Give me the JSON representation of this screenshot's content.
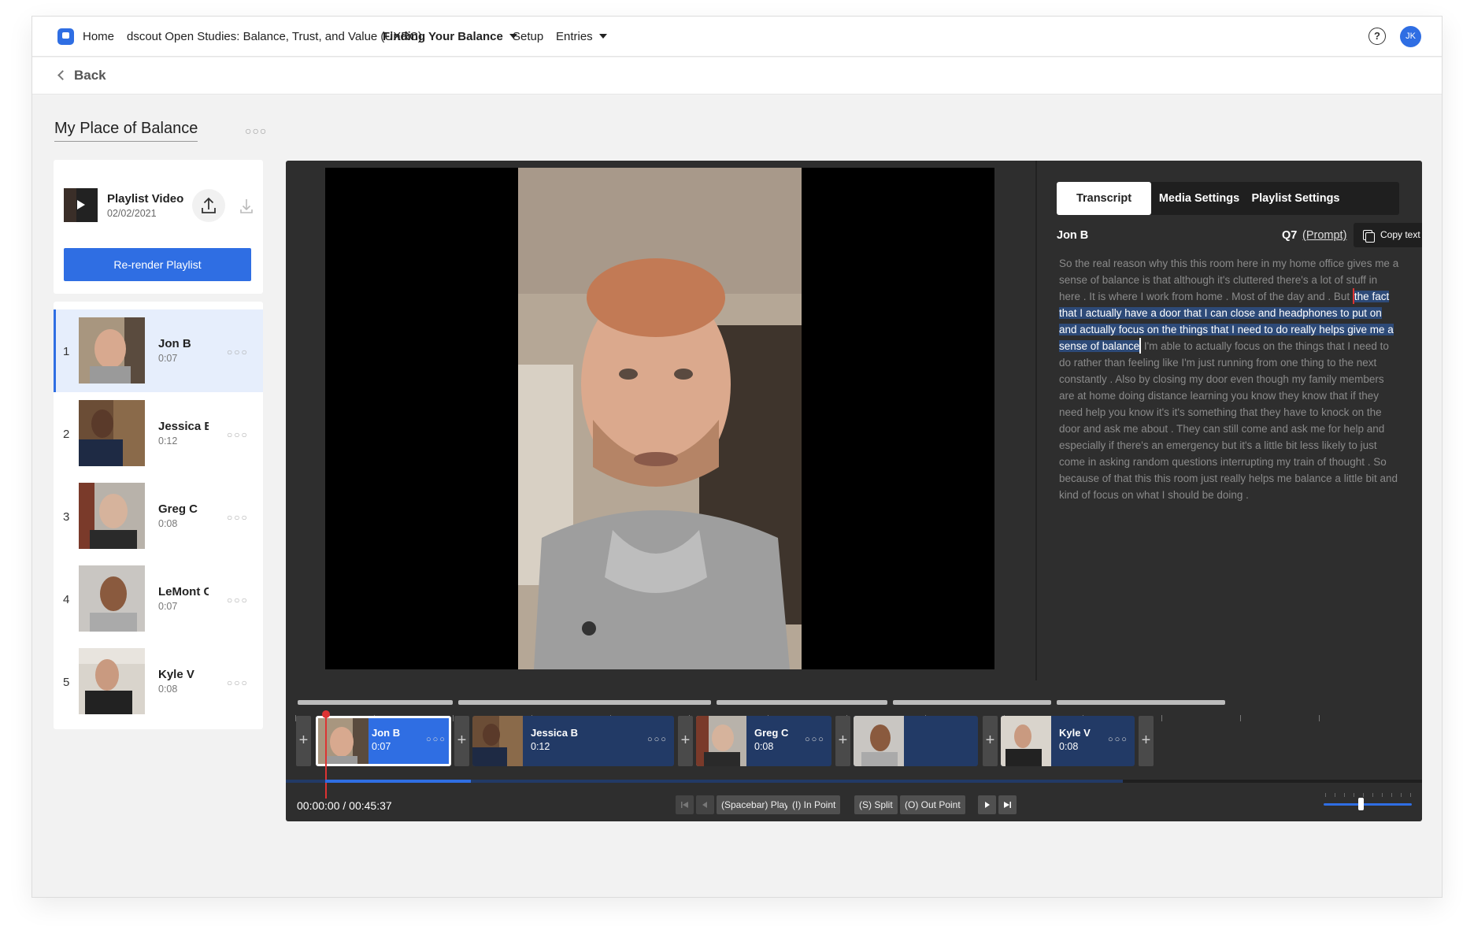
{
  "nav": {
    "home": "Home",
    "study": "dscout Open Studies: Balance, Trust, and Value (UXRC)",
    "mission": "Finding Your Balance",
    "setup": "Setup",
    "entries": "Entries",
    "help_symbol": "?",
    "user_initials": "JK"
  },
  "back_label": "Back",
  "page_title": "My Place of Balance",
  "playlist_video": {
    "title": "Playlist Video",
    "date": "02/02/2021",
    "rerender_label": "Re-render Playlist"
  },
  "playlist_items": [
    {
      "num": "1",
      "name": "Jon B",
      "duration": "0:07"
    },
    {
      "num": "2",
      "name": "Jessica B",
      "duration": "0:12"
    },
    {
      "num": "3",
      "name": "Greg C",
      "duration": "0:08"
    },
    {
      "num": "4",
      "name": "LeMont C",
      "duration": "0:07"
    },
    {
      "num": "5",
      "name": "Kyle V",
      "duration": "0:08"
    }
  ],
  "tabs": [
    "Transcript",
    "Media Settings",
    "Playlist Settings"
  ],
  "transcript": {
    "speaker": "Jon B",
    "question": "Q7",
    "prompt_link": "(Prompt)",
    "copy_label": "Copy text",
    "before": "So the real reason why this this room here in my home office gives me a sense of balance is that although it's cluttered there's a lot of stuff in here . It is where I work from home . Most of the day and . But ",
    "highlighted": "the fact that I actually have a door that I can close and headphones to put on and actually focus on the things that I need to do really helps give me a sense of balance",
    "after": " I'm able to actually focus on the things that I need to do rather than feeling like I'm just running from one thing to the next constantly . Also by closing my door even though my family members are at home doing distance learning you know they know that if they need help you know it's it's something that they have to knock on the door and ask me about . They can still come and ask me for help and especially if there's an emergency but it's a little bit less likely to just come in asking random questions interrupting my train of thought . So because of that this this room just really helps me balance a little bit and kind of focus on what I should be doing ."
  },
  "timeline_clips": [
    {
      "name": "Jon B",
      "duration": "0:07",
      "selected": true
    },
    {
      "name": "Jessica B",
      "duration": "0:12",
      "selected": false
    },
    {
      "name": "Greg C",
      "duration": "0:08",
      "selected": false
    },
    {
      "name": "",
      "duration": "",
      "selected": false
    },
    {
      "name": "Kyle V",
      "duration": "0:08",
      "selected": false
    }
  ],
  "add_symbol": "+",
  "more_symbol": "○○○",
  "playback": {
    "timecode": "00:00:00 / 00:45:37",
    "play_label": "(Spacebar) Play",
    "in_label": "(I) In Point",
    "split_label": "(S) Split",
    "out_label": "(O) Out Point",
    "progress_fraction": 0.13
  },
  "colors": {
    "accent": "#2f6ee3",
    "editor_bg": "#2e2e2e",
    "playhead": "#dd3333",
    "highlight": "#2d4a78"
  },
  "icons": [
    "app-logo-icon",
    "help-icon",
    "back-chevron-icon",
    "play-icon",
    "upload-icon",
    "download-icon",
    "copy-icon",
    "more-icon",
    "add-icon",
    "skip-start-icon",
    "step-back-icon",
    "step-forward-icon",
    "skip-end-icon"
  ]
}
